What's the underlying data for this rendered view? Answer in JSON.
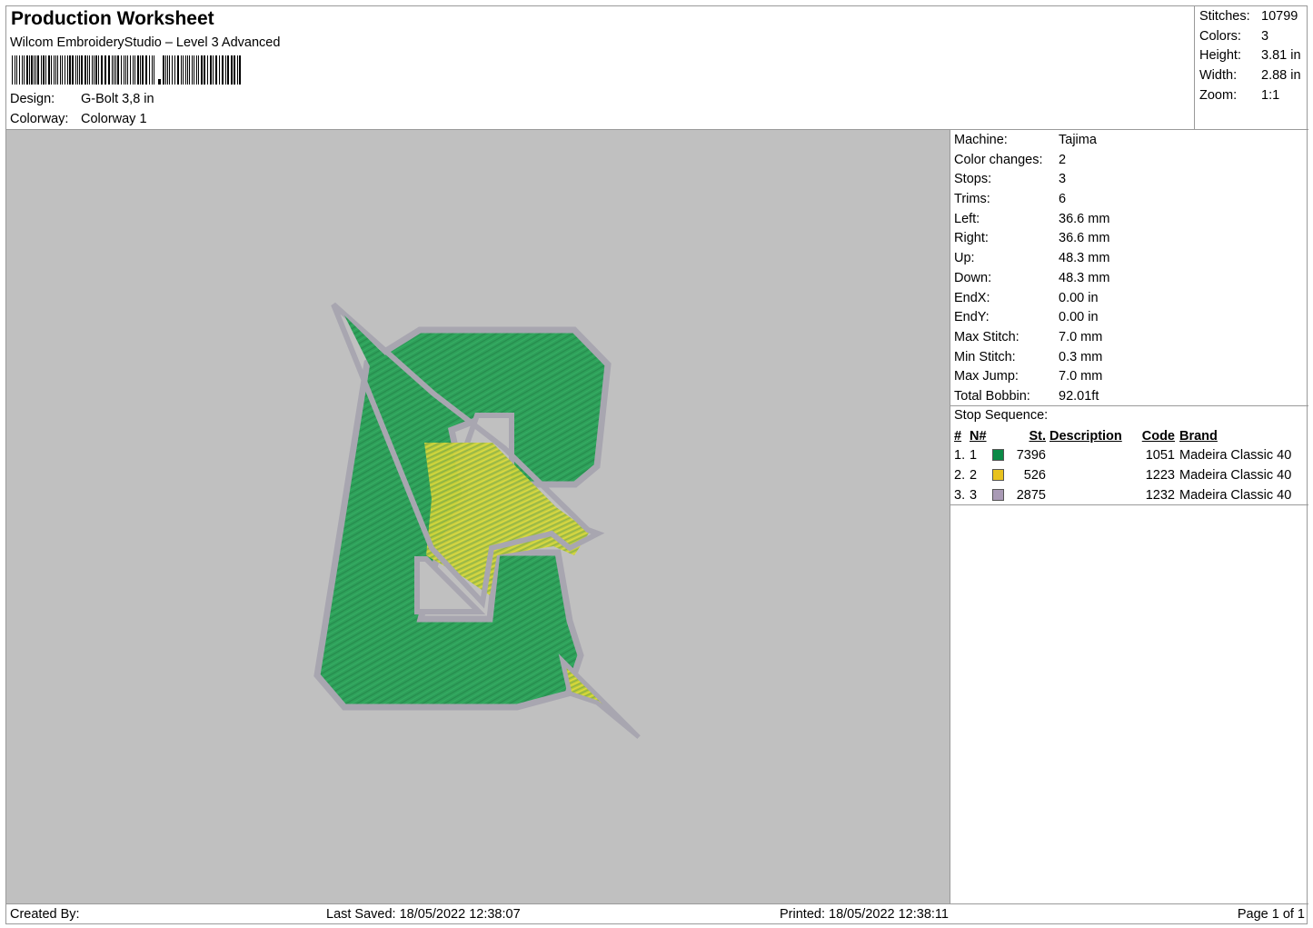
{
  "header": {
    "title": "Production Worksheet",
    "subtitle": "Wilcom EmbroideryStudio – Level 3 Advanced",
    "design_label": "Design:",
    "design_value": "G-Bolt 3,8 in",
    "colorway_label": "Colorway:",
    "colorway_value": "Colorway 1"
  },
  "summary": [
    {
      "label": "Stitches:",
      "value": "10799"
    },
    {
      "label": "Colors:",
      "value": "3"
    },
    {
      "label": "Height:",
      "value": "3.81 in"
    },
    {
      "label": "Width:",
      "value": "2.88 in"
    },
    {
      "label": "Zoom:",
      "value": "1:1"
    }
  ],
  "machine": [
    {
      "label": "Machine:",
      "value": "Tajima"
    },
    {
      "label": "Color changes:",
      "value": "2"
    },
    {
      "label": "Stops:",
      "value": "3"
    },
    {
      "label": "Trims:",
      "value": "6"
    },
    {
      "label": "Left:",
      "value": "36.6 mm"
    },
    {
      "label": "Right:",
      "value": "36.6 mm"
    },
    {
      "label": "Up:",
      "value": "48.3 mm"
    },
    {
      "label": "Down:",
      "value": "48.3 mm"
    },
    {
      "label": "EndX:",
      "value": "0.00 in"
    },
    {
      "label": "EndY:",
      "value": "0.00 in"
    },
    {
      "label": "Max Stitch:",
      "value": "7.0 mm"
    },
    {
      "label": "Min Stitch:",
      "value": "0.3 mm"
    },
    {
      "label": "Max Jump:",
      "value": "7.0 mm"
    },
    {
      "label": "Total Bobbin:",
      "value": "92.01ft"
    }
  ],
  "stop_sequence": {
    "caption": "Stop Sequence:",
    "columns": {
      "idx": "#",
      "n": "N#",
      "st": "St.",
      "desc": "Description",
      "code": "Code",
      "brand": "Brand"
    },
    "rows": [
      {
        "idx": "1.",
        "n": "1",
        "color": "#0a8a46",
        "st": "7396",
        "desc": "",
        "code": "1051",
        "brand": "Madeira Classic 40"
      },
      {
        "idx": "2.",
        "n": "2",
        "color": "#e8c21e",
        "st": "526",
        "desc": "",
        "code": "1223",
        "brand": "Madeira Classic 40"
      },
      {
        "idx": "3.",
        "n": "3",
        "color": "#a99ab5",
        "st": "2875",
        "desc": "",
        "code": "1232",
        "brand": "Madeira Classic 40"
      }
    ]
  },
  "colors": {
    "preview_bg": "#c0c0c0",
    "fill_green": "#2ea05a",
    "fill_yellow": "#c8d03a",
    "outline_gray": "#a8a6b0"
  },
  "footer": {
    "created_by": "Created By:",
    "last_saved": "Last Saved: 18/05/2022 12:38:07",
    "printed": "Printed: 18/05/2022 12:38:11",
    "page": "Page 1 of 1"
  }
}
